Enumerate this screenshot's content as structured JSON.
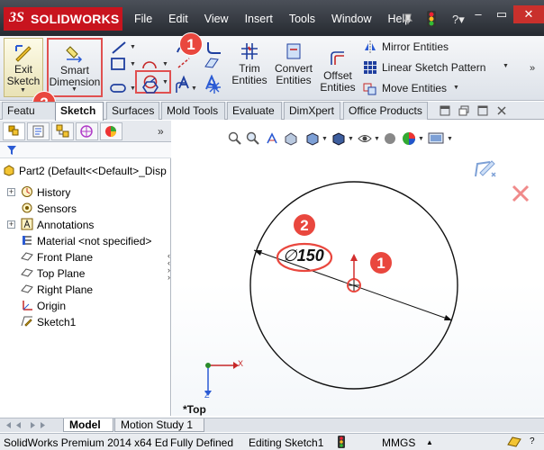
{
  "app": {
    "logo_ds": "3S",
    "logo_text": "SOLIDWORKS"
  },
  "menu": [
    "File",
    "Edit",
    "View",
    "Insert",
    "Tools",
    "Window",
    "Help"
  ],
  "window_buttons": {
    "minimize": "–",
    "restore": "▭",
    "close": "✕"
  },
  "command_manager": {
    "exit_sketch": {
      "line1": "Exit",
      "line2": "Sketch"
    },
    "smart_dimension": {
      "line1": "Smart",
      "line2": "Dimension"
    },
    "trim": {
      "line1": "Trim",
      "line2": "Entities"
    },
    "convert": {
      "line1": "Convert",
      "line2": "Entities"
    },
    "offset": {
      "line1": "Offset",
      "line2": "Entities"
    },
    "mirror": "Mirror Entities",
    "linear_pattern": "Linear Sketch Pattern",
    "move": "Move Entities"
  },
  "tabs": [
    "Features",
    "Sketch",
    "Surfaces",
    "Mold Tools",
    "Evaluate",
    "DimXpert",
    "Office Products"
  ],
  "tabs_visible": [
    "Featu",
    "Sketch",
    "Surfaces",
    "Mold Tools",
    "Evaluate",
    "DimXpert",
    "Office Products"
  ],
  "active_tab": "Sketch",
  "callouts": {
    "one": "1",
    "two": "2"
  },
  "tree": {
    "part": "Part2  (Default<<Default>_Disp",
    "items": [
      "History",
      "Sensors",
      "Annotations",
      "Material <not specified>",
      "Front Plane",
      "Top Plane",
      "Right Plane",
      "Origin",
      "Sketch1"
    ]
  },
  "viewport": {
    "dimension_value": "150",
    "diameter_symbol": "∅",
    "view_name": "*Top",
    "triad_x": "X",
    "triad_z": "Z"
  },
  "bottom_tabs": [
    "Model",
    "Motion Study 1"
  ],
  "status": {
    "product": "SolidWorks Premium 2014 x64 Ed",
    "state": "Fully Defined",
    "editing": "Editing Sketch1",
    "units": "MMGS"
  },
  "colors": {
    "accent_red": "#e9473e",
    "sketch_blue": "#1f4fbf",
    "logo_red": "#c8141e"
  }
}
